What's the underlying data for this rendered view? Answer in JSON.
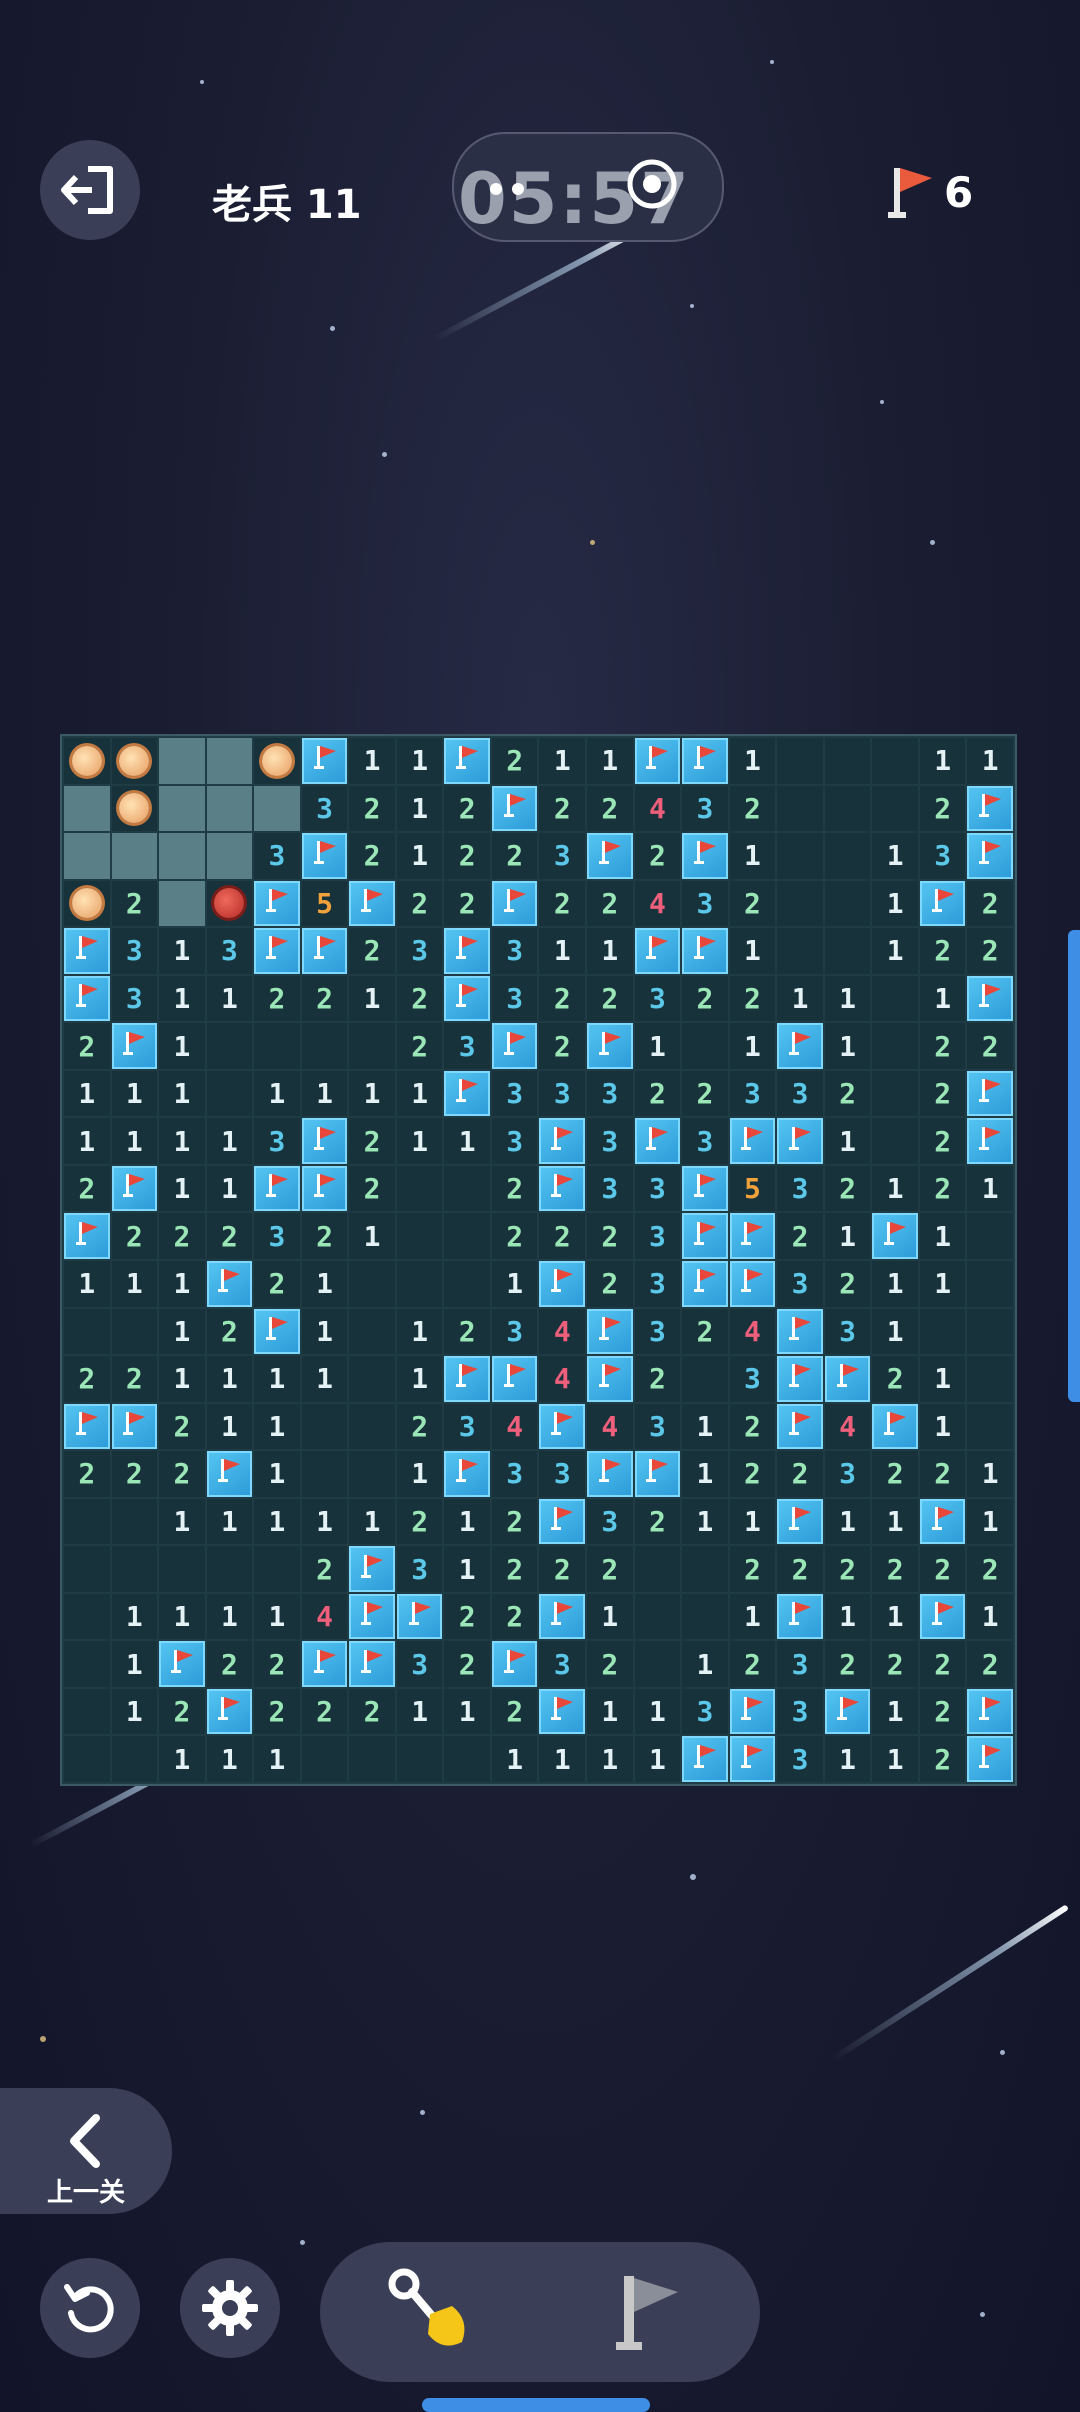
{
  "header": {
    "level": "老兵 11",
    "timer": "05:57",
    "flags_remaining": "6"
  },
  "navigation": {
    "prev_label": "上一关"
  },
  "colors": {
    "accent": "#3f8ee6",
    "flag_tile": "#2b9ad8",
    "board_bg": "#17323a",
    "num1": "#e4f2f5",
    "num2": "#9be6b6",
    "num3": "#5cc8e9",
    "num4": "#ee5f7c",
    "num5": "#f2a23a"
  },
  "icons": [
    "exit-icon",
    "stopwatch-icon",
    "flag-icon",
    "chevron-left-icon",
    "restart-icon",
    "gear-icon",
    "shovel-icon",
    "flag-tool-icon"
  ],
  "board": {
    "columns": 20,
    "rows": 22,
    "legend": {
      "M": "revealed-mine",
      "X": "exploded-mine",
      "F": "flag",
      "C": "covered",
      "0": "empty",
      "1-8": "number"
    },
    "cells": [
      [
        "M",
        "M",
        "C",
        "C",
        "M",
        "F",
        "1",
        "1",
        "F",
        "2",
        "1",
        "1",
        "F",
        "F",
        "1",
        "0",
        "0",
        "0",
        "1",
        "1"
      ],
      [
        "C",
        "M",
        "C",
        "C",
        "C",
        "3",
        "2",
        "1",
        "2",
        "F",
        "2",
        "2",
        "4",
        "3",
        "2",
        "0",
        "0",
        "0",
        "2",
        "F"
      ],
      [
        "C",
        "C",
        "C",
        "C",
        "3",
        "F",
        "2",
        "1",
        "2",
        "2",
        "3",
        "F",
        "2",
        "F",
        "1",
        "0",
        "0",
        "1",
        "3",
        "F"
      ],
      [
        "M",
        "2",
        "C",
        "X",
        "F",
        "5",
        "F",
        "2",
        "2",
        "F",
        "2",
        "2",
        "4",
        "3",
        "2",
        "0",
        "0",
        "1",
        "F",
        "2"
      ],
      [
        "F",
        "3",
        "1",
        "3",
        "F",
        "F",
        "2",
        "3",
        "F",
        "3",
        "1",
        "1",
        "F",
        "F",
        "1",
        "0",
        "0",
        "1",
        "2",
        "2"
      ],
      [
        "F",
        "3",
        "1",
        "1",
        "2",
        "2",
        "1",
        "2",
        "F",
        "3",
        "2",
        "2",
        "3",
        "2",
        "2",
        "1",
        "1",
        "0",
        "1",
        "F"
      ],
      [
        "2",
        "F",
        "1",
        "0",
        "0",
        "0",
        "0",
        "2",
        "3",
        "F",
        "2",
        "F",
        "1",
        "0",
        "1",
        "F",
        "1",
        "0",
        "2",
        "2"
      ],
      [
        "1",
        "1",
        "1",
        "0",
        "1",
        "1",
        "1",
        "1",
        "F",
        "3",
        "3",
        "3",
        "2",
        "2",
        "3",
        "3",
        "2",
        "0",
        "2",
        "F"
      ],
      [
        "1",
        "1",
        "1",
        "1",
        "3",
        "F",
        "2",
        "1",
        "1",
        "3",
        "F",
        "3",
        "F",
        "3",
        "F",
        "F",
        "1",
        "0",
        "2",
        "F"
      ],
      [
        "2",
        "F",
        "1",
        "1",
        "F",
        "F",
        "2",
        "0",
        "0",
        "2",
        "F",
        "3",
        "3",
        "F",
        "5",
        "3",
        "2",
        "1",
        "2",
        "1"
      ],
      [
        "F",
        "2",
        "2",
        "2",
        "3",
        "2",
        "1",
        "0",
        "0",
        "2",
        "2",
        "2",
        "3",
        "F",
        "F",
        "2",
        "1",
        "F",
        "1",
        "0"
      ],
      [
        "1",
        "1",
        "1",
        "F",
        "2",
        "1",
        "0",
        "0",
        "0",
        "1",
        "F",
        "2",
        "3",
        "F",
        "F",
        "3",
        "2",
        "1",
        "1",
        "0"
      ],
      [
        "0",
        "0",
        "1",
        "2",
        "F",
        "1",
        "0",
        "1",
        "2",
        "3",
        "4",
        "F",
        "3",
        "2",
        "4",
        "F",
        "3",
        "1",
        "0",
        "0"
      ],
      [
        "2",
        "2",
        "1",
        "1",
        "1",
        "1",
        "0",
        "1",
        "F",
        "F",
        "4",
        "F",
        "2",
        "0",
        "3",
        "F",
        "F",
        "2",
        "1",
        "0"
      ],
      [
        "F",
        "F",
        "2",
        "1",
        "1",
        "0",
        "0",
        "2",
        "3",
        "4",
        "F",
        "4",
        "3",
        "1",
        "2",
        "F",
        "4",
        "F",
        "1",
        "0"
      ],
      [
        "2",
        "2",
        "2",
        "F",
        "1",
        "0",
        "0",
        "1",
        "F",
        "3",
        "3",
        "F",
        "F",
        "1",
        "2",
        "2",
        "3",
        "2",
        "2",
        "1"
      ],
      [
        "0",
        "0",
        "1",
        "1",
        "1",
        "1",
        "1",
        "2",
        "1",
        "2",
        "F",
        "3",
        "2",
        "1",
        "1",
        "F",
        "1",
        "1",
        "F",
        "1"
      ],
      [
        "0",
        "0",
        "0",
        "0",
        "0",
        "2",
        "F",
        "3",
        "1",
        "2",
        "2",
        "2",
        "0",
        "0",
        "2",
        "2",
        "2",
        "2",
        "2",
        "2"
      ],
      [
        "0",
        "1",
        "1",
        "1",
        "1",
        "4",
        "F",
        "F",
        "2",
        "2",
        "F",
        "1",
        "0",
        "0",
        "1",
        "F",
        "1",
        "1",
        "F",
        "1"
      ],
      [
        "0",
        "1",
        "F",
        "2",
        "2",
        "F",
        "F",
        "3",
        "2",
        "F",
        "3",
        "2",
        "0",
        "1",
        "2",
        "3",
        "2",
        "2",
        "2",
        "2"
      ],
      [
        "0",
        "1",
        "2",
        "F",
        "2",
        "2",
        "2",
        "1",
        "1",
        "2",
        "F",
        "1",
        "1",
        "3",
        "F",
        "3",
        "F",
        "1",
        "2",
        "F"
      ],
      [
        "0",
        "0",
        "1",
        "1",
        "1",
        "0",
        "0",
        "0",
        "0",
        "1",
        "1",
        "1",
        "1",
        "F",
        "F",
        "3",
        "1",
        "1",
        "2",
        "F"
      ]
    ]
  }
}
